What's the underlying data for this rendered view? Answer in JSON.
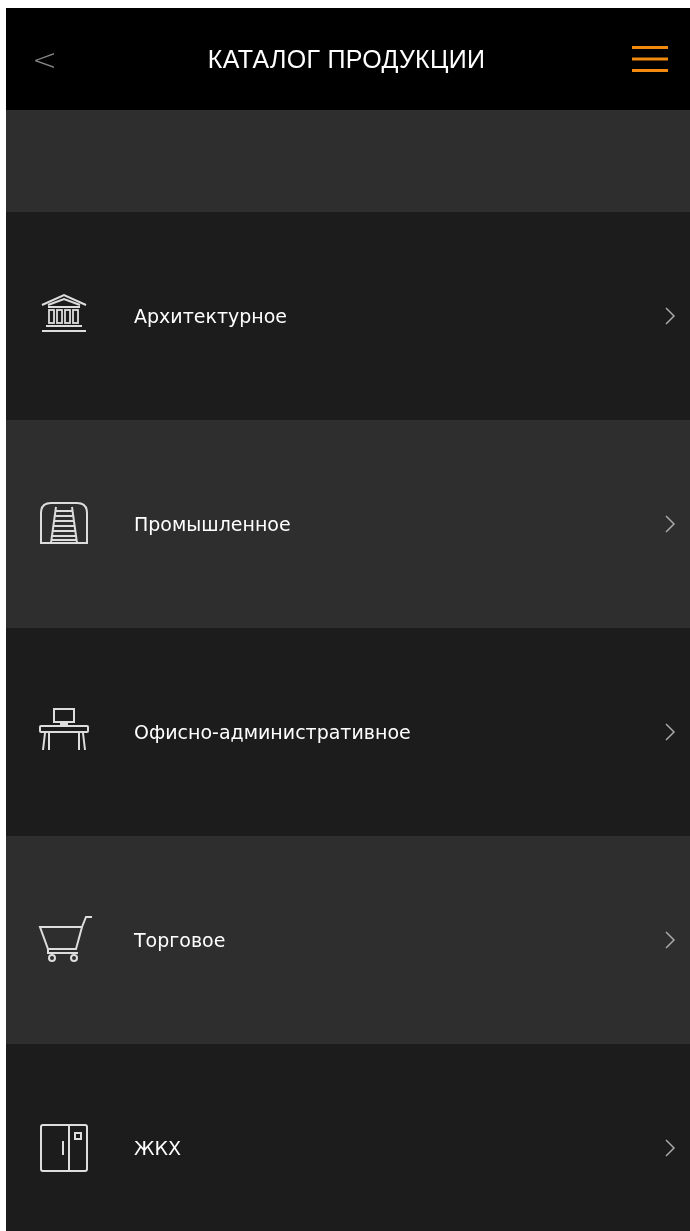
{
  "header": {
    "back": "<",
    "title": "КАТАЛОГ ПРОДУКЦИИ"
  },
  "items": [
    {
      "kind": "architecture",
      "label": "Архитектурное"
    },
    {
      "kind": "industrial",
      "label": "Промышленное"
    },
    {
      "kind": "office",
      "label": "Офисно-административное"
    },
    {
      "kind": "retail",
      "label": "Торговое"
    },
    {
      "kind": "housing",
      "label": "ЖКХ"
    }
  ]
}
